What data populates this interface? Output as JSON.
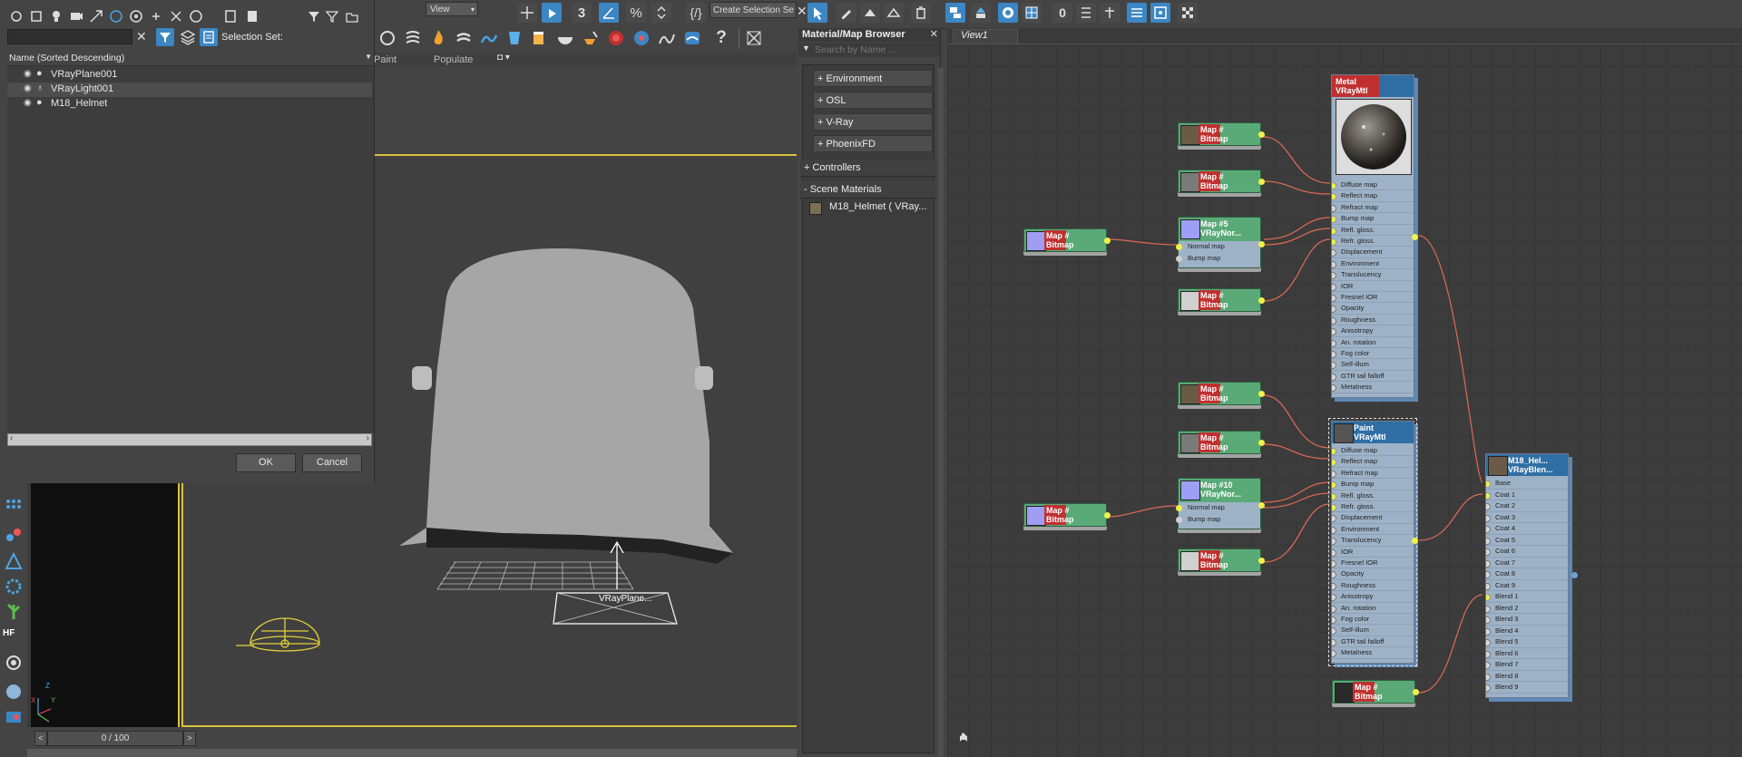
{
  "main_toolbar": {
    "view_dropdown": "View",
    "selection_set_field": "Create Selection Se"
  },
  "explorer": {
    "search_value": "",
    "selection_set_label": "Selection Set:",
    "column_header": "Name (Sorted Descending)",
    "items": [
      {
        "name": "VRayPlane001"
      },
      {
        "name": "VRayLight001"
      },
      {
        "name": "M18_Helmet"
      }
    ],
    "ok_label": "OK",
    "cancel_label": "Cancel"
  },
  "ribbon_tabs": [
    "Paint",
    "Populate"
  ],
  "viewport": {
    "plane_label": "VRayPlane...",
    "axis_x": "X",
    "axis_y": "Y",
    "axis_z": "Z"
  },
  "timeline": {
    "frame_counter": "0 / 100",
    "prev": "<",
    "next": ">"
  },
  "left_tools": {
    "hf_label": "HF"
  },
  "material_browser": {
    "title": "Material/Map Browser",
    "search_placeholder": "Search by Name ...",
    "categories": [
      "+ Environment",
      "+ OSL",
      "+ V-Ray",
      "+ PhoenixFD"
    ],
    "controllers_label": "+ Controllers",
    "scene_materials_label": "- Scene Materials",
    "scene_material_item": "M18_Helmet  ( VRay..."
  },
  "node_editor": {
    "view_tab": "View1",
    "nodes": {
      "metal_mtl_name": "Metal",
      "metal_mtl_type": "VRayMtl",
      "paint_mtl_name": "Paint",
      "paint_mtl_type": "VRayMtl",
      "blend_name": "M18_Hel...",
      "blend_type": "VRayBlen...",
      "normal_map_1_name": "Map #5",
      "normal_map_1_type": "VRayNor...",
      "normal_map_2_name": "Map #10",
      "normal_map_2_type": "VRayNor...",
      "normal_map_slot": "Normal map",
      "bump_map_slot": "Bump map",
      "bitmap_label": "Bitmap",
      "bitmap_map_label": "Map #"
    },
    "vray_mtl_slots": [
      "Diffuse map",
      "Reflect map",
      "Refract map",
      "Bump map",
      "Refl. gloss.",
      "Refr. gloss.",
      "Displacement",
      "Environment",
      "Translucency",
      "IOR",
      "Fresnel IOR",
      "Opacity",
      "Roughness",
      "Anisotropy",
      "An. rotation",
      "Fog color",
      "Self-illum",
      "GTR tail falloff",
      "Metalness"
    ],
    "blend_slots": [
      "Base",
      "Coat 1",
      "Coat 2",
      "Coat 3",
      "Coat 4",
      "Coat 5",
      "Coat 6",
      "Coat 7",
      "Coat 8",
      "Coat 9",
      "Blend 1",
      "Blend 2",
      "Blend 3",
      "Blend 4",
      "Blend 5",
      "Blend 6",
      "Blend 7",
      "Blend 8",
      "Blend 9"
    ]
  },
  "colors": {
    "accent_blue": "#3c86c4",
    "node_green": "#5aaa78",
    "node_red": "#c0302f",
    "wire": "#e06a55",
    "viewport_border": "#d9c23a"
  }
}
